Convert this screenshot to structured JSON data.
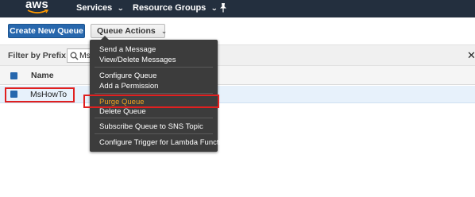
{
  "nav": {
    "logo_text": "aws",
    "services_label": "Services",
    "resource_groups_label": "Resource Groups",
    "pin_icon": "pin-icon",
    "bg_color": "#232f3e",
    "logo_accent": "#ff9900"
  },
  "toolbar": {
    "create_label": "Create New Queue",
    "actions_label": "Queue Actions",
    "primary_color": "#2767ad"
  },
  "filter": {
    "label": "Filter by Prefix:",
    "value": "Ms",
    "search_icon": "search-icon",
    "clear_glyph": "✕"
  },
  "table": {
    "columns": [
      "Name"
    ],
    "rows": [
      {
        "name": "MsHowTo",
        "selected": true
      }
    ]
  },
  "menu": {
    "groups": [
      [
        "Send a Message",
        "View/Delete Messages"
      ],
      [
        "Configure Queue",
        "Add a Permission"
      ],
      [
        "Purge Queue",
        "Delete Queue"
      ],
      [
        "Subscribe Queue to SNS Topic"
      ],
      [
        "Configure Trigger for Lambda Function"
      ]
    ],
    "highlighted_item": "Purge Queue",
    "highlight_color": "#f0a020"
  },
  "annotations": {
    "box_color": "#e02020"
  }
}
